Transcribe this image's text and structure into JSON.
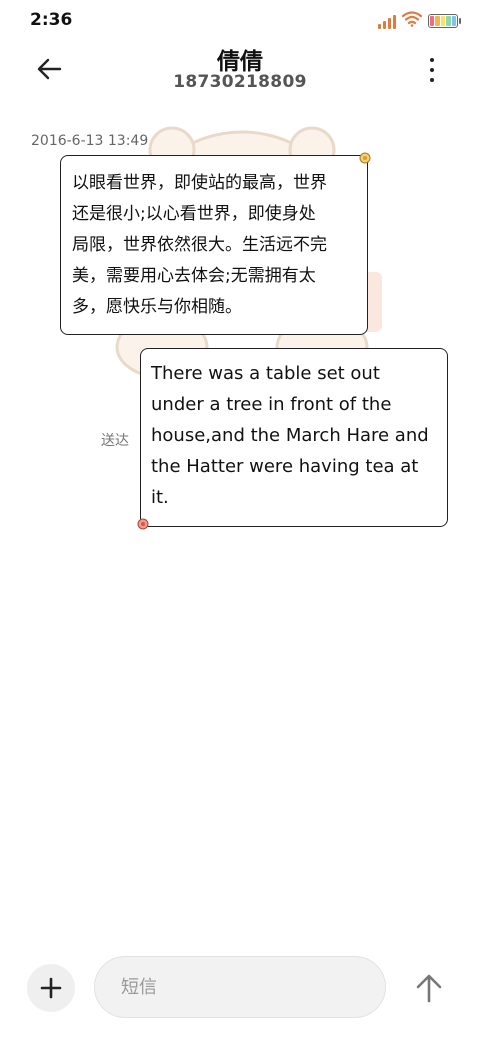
{
  "status_bar": {
    "time": "2:36",
    "icons": [
      "signal-icon",
      "wifi-icon",
      "battery-icon"
    ],
    "signal_color": "#e27a3f",
    "wifi_color": "#e27a3f",
    "battery_colors": [
      "#f16a7c",
      "#f5b54a",
      "#f7e36b",
      "#8fd9a8",
      "#7cc4f4"
    ]
  },
  "header": {
    "contact_name": "倩倩",
    "phone_number": "18730218809",
    "back_icon": "back-arrow-icon",
    "menu_icon": "more-vertical-icon"
  },
  "conversation": {
    "timestamp": "2016-6-13 13:49",
    "received_message": {
      "lines": [
        "以眼看世界，即使站的最高，世界",
        "还是很小;以心看世界，即使身处",
        "局限，世界依然很大。生活远不完",
        "美，需要用心去体会;无需拥有太",
        "多，愿快乐与你相随。"
      ]
    },
    "sent_message": {
      "lines": [
        "There was a table set out",
        "under a tree in front of the",
        "house,and the March Hare and",
        "the Hatter were having tea at",
        "it."
      ],
      "status": "送达"
    }
  },
  "input_bar": {
    "placeholder": "短信",
    "add_icon": "plus-icon",
    "send_icon": "send-arrow-icon"
  },
  "colors": {
    "bubble_border": "#222222",
    "illustration": "#f1dcc6"
  }
}
